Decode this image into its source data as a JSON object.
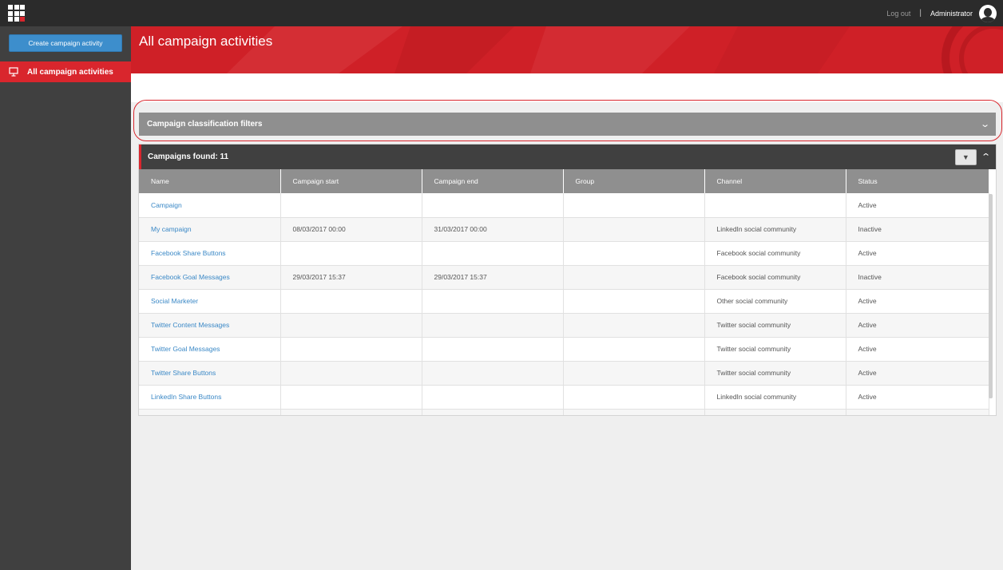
{
  "topbar": {
    "logout": "Log out",
    "separator": "|",
    "user": "Administrator",
    "app_icon": "app-grid-icon",
    "avatar_icon": "user-avatar-icon"
  },
  "sidebar": {
    "create_button": "Create campaign activity",
    "items": [
      {
        "label": "All campaign activities",
        "icon": "presentation-board-icon",
        "active": true
      }
    ]
  },
  "header": {
    "title": "All campaign activities",
    "accent_color": "#d9262d"
  },
  "filters": {
    "label": "Campaign classification filters",
    "icon": "chevron-down-icon"
  },
  "grid": {
    "found_label": "Campaigns found: 11",
    "dropdown_icon": "caret-down-icon",
    "collapse_icon": "chevron-up-icon",
    "columns": [
      "Name",
      "Campaign start",
      "Campaign end",
      "Group",
      "Channel",
      "Status"
    ],
    "rows": [
      {
        "name": "Campaign",
        "start": "",
        "end": "",
        "group": "",
        "channel": "",
        "status": "Active"
      },
      {
        "name": "My campaign",
        "start": "08/03/2017 00:00",
        "end": "31/03/2017 00:00",
        "group": "",
        "channel": "LinkedIn social community",
        "status": "Inactive"
      },
      {
        "name": "Facebook Share Buttons",
        "start": "",
        "end": "",
        "group": "",
        "channel": "Facebook social community",
        "status": "Active"
      },
      {
        "name": "Facebook Goal Messages",
        "start": "29/03/2017 15:37",
        "end": "29/03/2017 15:37",
        "group": "",
        "channel": "Facebook social community",
        "status": "Inactive"
      },
      {
        "name": "Social Marketer",
        "start": "",
        "end": "",
        "group": "",
        "channel": "Other social community",
        "status": "Active"
      },
      {
        "name": "Twitter Content Messages",
        "start": "",
        "end": "",
        "group": "",
        "channel": "Twitter social community",
        "status": "Active"
      },
      {
        "name": "Twitter Goal Messages",
        "start": "",
        "end": "",
        "group": "",
        "channel": "Twitter social community",
        "status": "Active"
      },
      {
        "name": "Twitter Share Buttons",
        "start": "",
        "end": "",
        "group": "",
        "channel": "Twitter social community",
        "status": "Active"
      },
      {
        "name": "LinkedIn Share Buttons",
        "start": "",
        "end": "",
        "group": "",
        "channel": "LinkedIn social community",
        "status": "Active"
      }
    ]
  }
}
